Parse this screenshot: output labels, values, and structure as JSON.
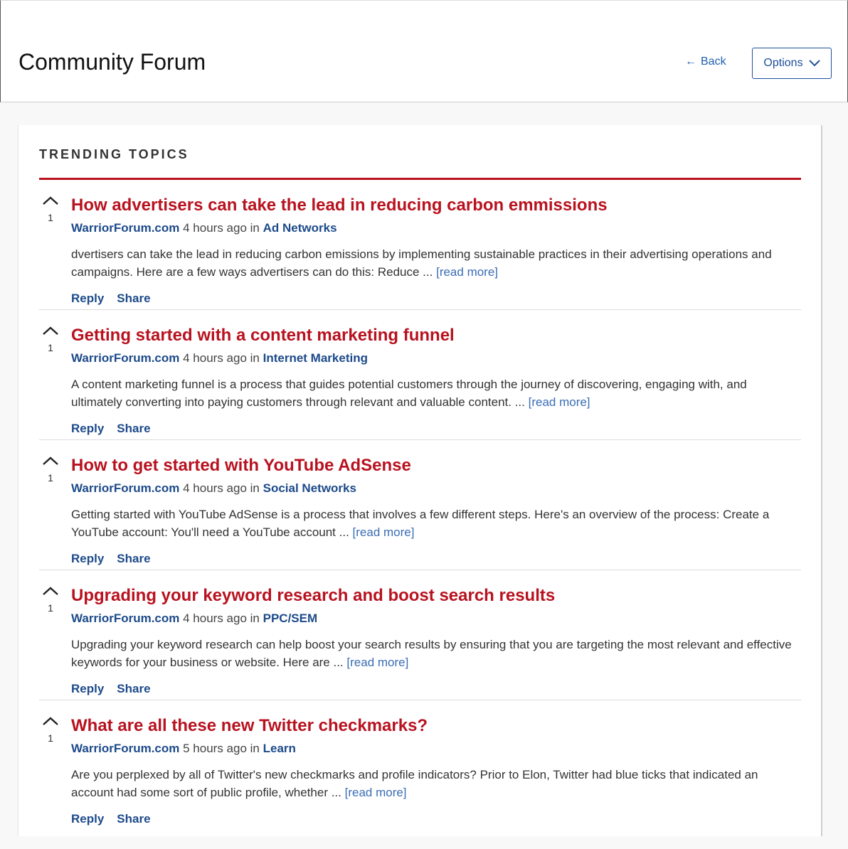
{
  "header": {
    "title": "Community Forum",
    "back_label": "Back",
    "options_label": "Options"
  },
  "section": {
    "title": "TRENDING TOPICS",
    "accent_color": "#b8121f"
  },
  "topics": [
    {
      "votes": "1",
      "title": "How advertisers can take the lead in reducing carbon emmissions",
      "site": "WarriorForum.com",
      "time": "4 hours ago",
      "in_word": "in",
      "category": "Ad Networks",
      "excerpt": "dvertisers can take the lead in reducing carbon emissions by implementing sustainable practices in their advertising operations and campaigns. Here are a few ways advertisers can do this: Reduce ...",
      "read_more": "[read more]",
      "reply": "Reply",
      "share": "Share"
    },
    {
      "votes": "1",
      "title": "Getting started with a content marketing funnel",
      "site": "WarriorForum.com",
      "time": "4 hours ago",
      "in_word": "in",
      "category": "Internet Marketing",
      "excerpt": "A content marketing funnel is a process that guides potential customers through the journey of discovering, engaging with, and ultimately converting into paying customers through relevant and valuable content. ...",
      "read_more": "[read more]",
      "reply": "Reply",
      "share": "Share"
    },
    {
      "votes": "1",
      "title": "How to get started with YouTube AdSense",
      "site": "WarriorForum.com",
      "time": "4 hours ago",
      "in_word": "in",
      "category": "Social Networks",
      "excerpt": "Getting started with YouTube AdSense is a process that involves a few different steps. Here's an overview of the process: Create a YouTube account: You'll need a YouTube account ...",
      "read_more": "[read more]",
      "reply": "Reply",
      "share": "Share"
    },
    {
      "votes": "1",
      "title": "Upgrading your keyword research and boost search results",
      "site": "WarriorForum.com",
      "time": "4 hours ago",
      "in_word": "in",
      "category": "PPC/SEM",
      "excerpt": "Upgrading your keyword research can help boost your search results by ensuring that you are targeting the most relevant and effective keywords for your business or website. Here are ...",
      "read_more": "[read more]",
      "reply": "Reply",
      "share": "Share"
    },
    {
      "votes": "1",
      "title": "What are all these new Twitter checkmarks?",
      "site": "WarriorForum.com",
      "time": "5 hours ago",
      "in_word": "in",
      "category": "Learn",
      "excerpt": "Are you perplexed by all of Twitter's new checkmarks and profile indicators? Prior to Elon, Twitter had blue ticks that indicated an account had some sort of public profile, whether ...",
      "read_more": "[read more]",
      "reply": "Reply",
      "share": "Share"
    }
  ]
}
